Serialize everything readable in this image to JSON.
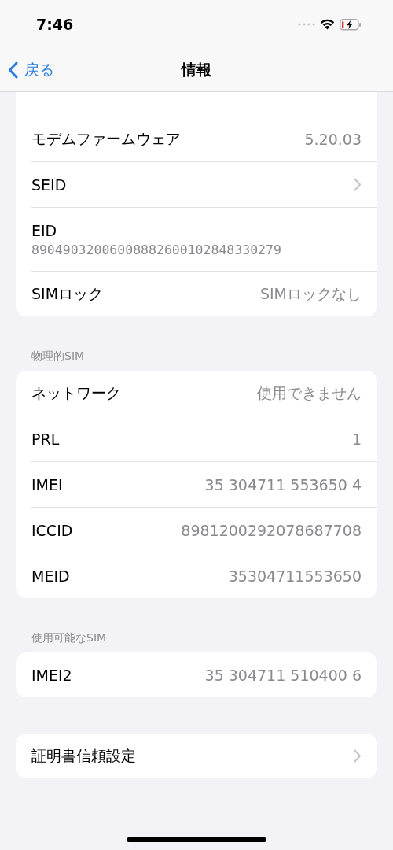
{
  "status_bar": {
    "time": "7:46"
  },
  "nav": {
    "back": "戻る",
    "title": "情報"
  },
  "sections": [
    {
      "rows": [
        {
          "kind": "value",
          "label": "モデムファームウェア",
          "value": "5.20.03"
        },
        {
          "kind": "chevron",
          "label": "SEID"
        },
        {
          "kind": "stacked",
          "label": "EID",
          "value": "89049032006008882600102848330279"
        },
        {
          "kind": "value",
          "label": "SIMロック",
          "value": "SIMロックなし"
        }
      ]
    },
    {
      "header": "物理的SIM",
      "rows": [
        {
          "kind": "value",
          "label": "ネットワーク",
          "value": "使用できません"
        },
        {
          "kind": "value",
          "label": "PRL",
          "value": "1"
        },
        {
          "kind": "value",
          "label": "IMEI",
          "value": "35 304711 553650 4"
        },
        {
          "kind": "value",
          "label": "ICCID",
          "value": "8981200292078687708"
        },
        {
          "kind": "value",
          "label": "MEID",
          "value": "35304711553650"
        }
      ]
    },
    {
      "header": "使用可能なSIM",
      "rows": [
        {
          "kind": "value",
          "label": "IMEI2",
          "value": "35 304711 510400 6"
        }
      ]
    },
    {
      "rows": [
        {
          "kind": "chevron",
          "label": "証明書信頼設定"
        }
      ]
    }
  ]
}
